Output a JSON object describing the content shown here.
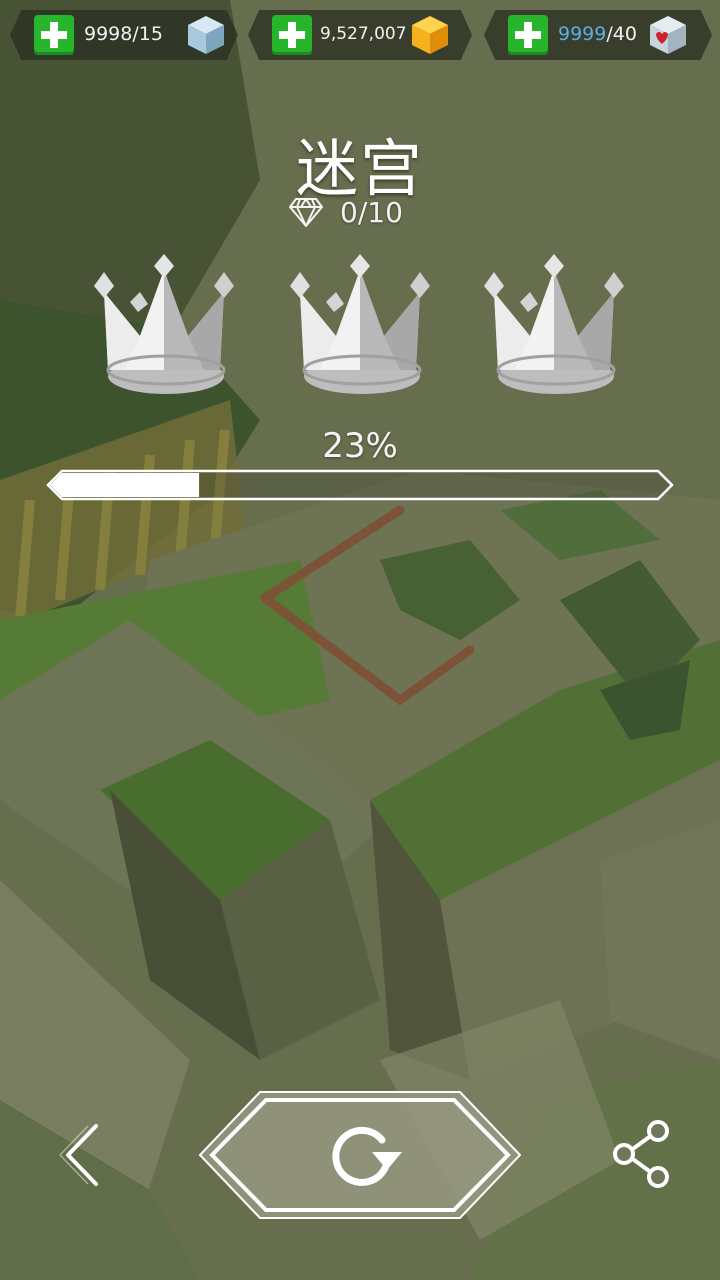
{
  "resources": {
    "lives": {
      "value": "9998/15"
    },
    "coins": {
      "value": "9,527,007"
    },
    "hearts": {
      "value_highlight": "9999",
      "value_rest": "/40"
    }
  },
  "level": {
    "title": "迷宫",
    "gems": "0/10",
    "crowns_earned": 0,
    "crowns_total": 3,
    "progress_label": "23%",
    "progress": 0.23
  },
  "colors": {
    "plus_green": "#27b52c",
    "ice_cube": "#a8c8dc",
    "gold_cube": "#f5b21c",
    "heart_red": "#d0202a",
    "highlight_blue": "#5aaee6"
  },
  "icons": {
    "back": "chevron-left-icon",
    "replay": "replay-icon",
    "share": "share-icon"
  }
}
